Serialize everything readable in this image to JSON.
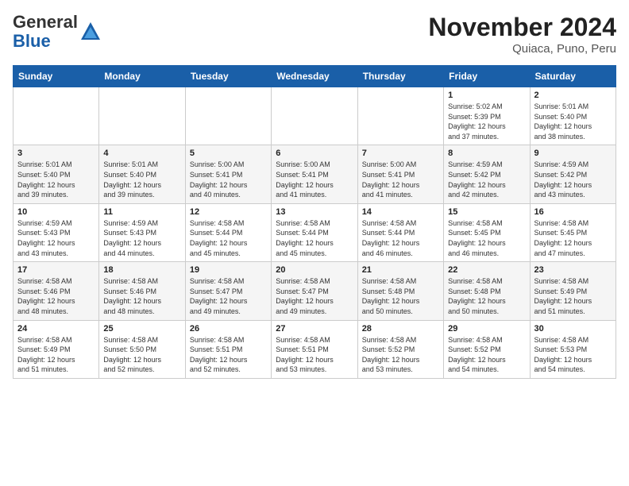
{
  "logo": {
    "general": "General",
    "blue": "Blue"
  },
  "header": {
    "month_year": "November 2024",
    "location": "Quiaca, Puno, Peru"
  },
  "weekdays": [
    "Sunday",
    "Monday",
    "Tuesday",
    "Wednesday",
    "Thursday",
    "Friday",
    "Saturday"
  ],
  "weeks": [
    [
      {
        "day": "",
        "info": ""
      },
      {
        "day": "",
        "info": ""
      },
      {
        "day": "",
        "info": ""
      },
      {
        "day": "",
        "info": ""
      },
      {
        "day": "",
        "info": ""
      },
      {
        "day": "1",
        "info": "Sunrise: 5:02 AM\nSunset: 5:39 PM\nDaylight: 12 hours\nand 37 minutes."
      },
      {
        "day": "2",
        "info": "Sunrise: 5:01 AM\nSunset: 5:40 PM\nDaylight: 12 hours\nand 38 minutes."
      }
    ],
    [
      {
        "day": "3",
        "info": "Sunrise: 5:01 AM\nSunset: 5:40 PM\nDaylight: 12 hours\nand 39 minutes."
      },
      {
        "day": "4",
        "info": "Sunrise: 5:01 AM\nSunset: 5:40 PM\nDaylight: 12 hours\nand 39 minutes."
      },
      {
        "day": "5",
        "info": "Sunrise: 5:00 AM\nSunset: 5:41 PM\nDaylight: 12 hours\nand 40 minutes."
      },
      {
        "day": "6",
        "info": "Sunrise: 5:00 AM\nSunset: 5:41 PM\nDaylight: 12 hours\nand 41 minutes."
      },
      {
        "day": "7",
        "info": "Sunrise: 5:00 AM\nSunset: 5:41 PM\nDaylight: 12 hours\nand 41 minutes."
      },
      {
        "day": "8",
        "info": "Sunrise: 4:59 AM\nSunset: 5:42 PM\nDaylight: 12 hours\nand 42 minutes."
      },
      {
        "day": "9",
        "info": "Sunrise: 4:59 AM\nSunset: 5:42 PM\nDaylight: 12 hours\nand 43 minutes."
      }
    ],
    [
      {
        "day": "10",
        "info": "Sunrise: 4:59 AM\nSunset: 5:43 PM\nDaylight: 12 hours\nand 43 minutes."
      },
      {
        "day": "11",
        "info": "Sunrise: 4:59 AM\nSunset: 5:43 PM\nDaylight: 12 hours\nand 44 minutes."
      },
      {
        "day": "12",
        "info": "Sunrise: 4:58 AM\nSunset: 5:44 PM\nDaylight: 12 hours\nand 45 minutes."
      },
      {
        "day": "13",
        "info": "Sunrise: 4:58 AM\nSunset: 5:44 PM\nDaylight: 12 hours\nand 45 minutes."
      },
      {
        "day": "14",
        "info": "Sunrise: 4:58 AM\nSunset: 5:44 PM\nDaylight: 12 hours\nand 46 minutes."
      },
      {
        "day": "15",
        "info": "Sunrise: 4:58 AM\nSunset: 5:45 PM\nDaylight: 12 hours\nand 46 minutes."
      },
      {
        "day": "16",
        "info": "Sunrise: 4:58 AM\nSunset: 5:45 PM\nDaylight: 12 hours\nand 47 minutes."
      }
    ],
    [
      {
        "day": "17",
        "info": "Sunrise: 4:58 AM\nSunset: 5:46 PM\nDaylight: 12 hours\nand 48 minutes."
      },
      {
        "day": "18",
        "info": "Sunrise: 4:58 AM\nSunset: 5:46 PM\nDaylight: 12 hours\nand 48 minutes."
      },
      {
        "day": "19",
        "info": "Sunrise: 4:58 AM\nSunset: 5:47 PM\nDaylight: 12 hours\nand 49 minutes."
      },
      {
        "day": "20",
        "info": "Sunrise: 4:58 AM\nSunset: 5:47 PM\nDaylight: 12 hours\nand 49 minutes."
      },
      {
        "day": "21",
        "info": "Sunrise: 4:58 AM\nSunset: 5:48 PM\nDaylight: 12 hours\nand 50 minutes."
      },
      {
        "day": "22",
        "info": "Sunrise: 4:58 AM\nSunset: 5:48 PM\nDaylight: 12 hours\nand 50 minutes."
      },
      {
        "day": "23",
        "info": "Sunrise: 4:58 AM\nSunset: 5:49 PM\nDaylight: 12 hours\nand 51 minutes."
      }
    ],
    [
      {
        "day": "24",
        "info": "Sunrise: 4:58 AM\nSunset: 5:49 PM\nDaylight: 12 hours\nand 51 minutes."
      },
      {
        "day": "25",
        "info": "Sunrise: 4:58 AM\nSunset: 5:50 PM\nDaylight: 12 hours\nand 52 minutes."
      },
      {
        "day": "26",
        "info": "Sunrise: 4:58 AM\nSunset: 5:51 PM\nDaylight: 12 hours\nand 52 minutes."
      },
      {
        "day": "27",
        "info": "Sunrise: 4:58 AM\nSunset: 5:51 PM\nDaylight: 12 hours\nand 53 minutes."
      },
      {
        "day": "28",
        "info": "Sunrise: 4:58 AM\nSunset: 5:52 PM\nDaylight: 12 hours\nand 53 minutes."
      },
      {
        "day": "29",
        "info": "Sunrise: 4:58 AM\nSunset: 5:52 PM\nDaylight: 12 hours\nand 54 minutes."
      },
      {
        "day": "30",
        "info": "Sunrise: 4:58 AM\nSunset: 5:53 PM\nDaylight: 12 hours\nand 54 minutes."
      }
    ]
  ]
}
